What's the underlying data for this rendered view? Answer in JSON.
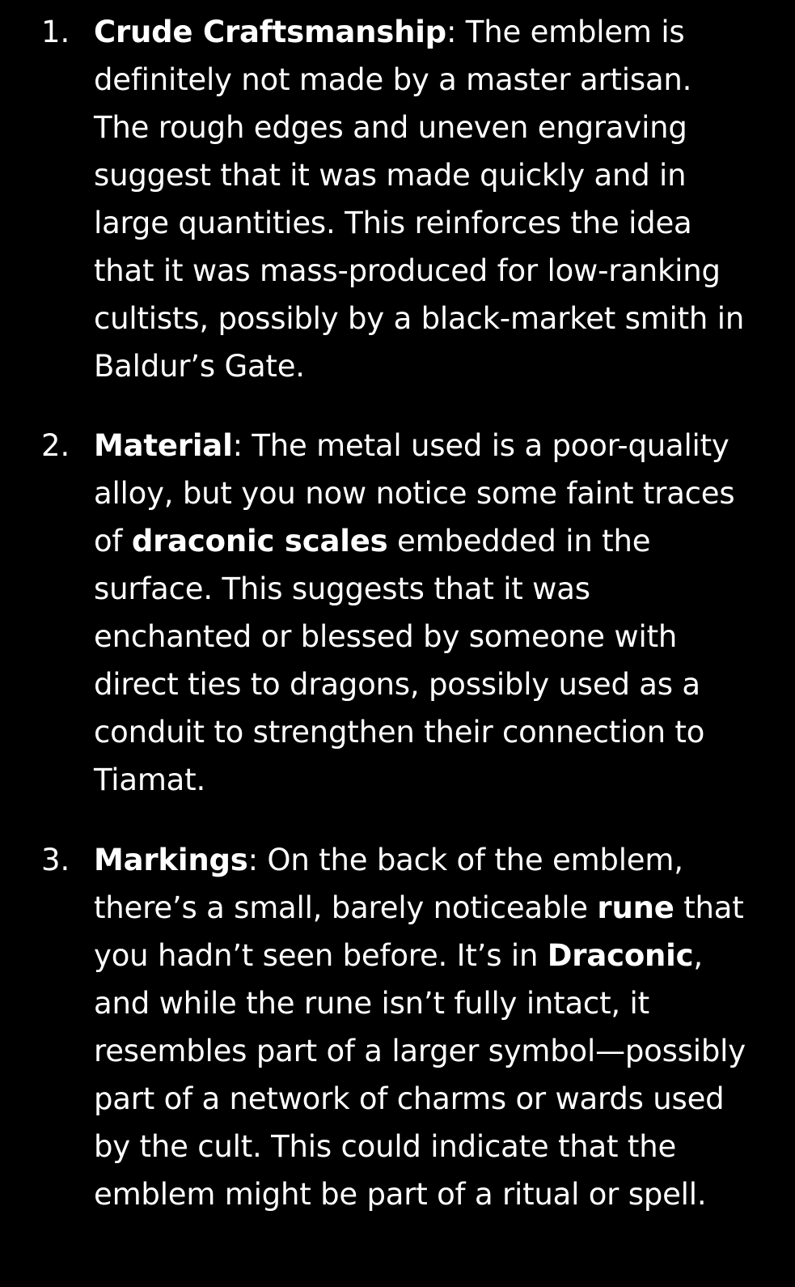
{
  "list": {
    "items": [
      {
        "number": "1.",
        "heading": "Crude Craftsmanship",
        "body": ": The emblem is definitely not made by a master artisan. The rough edges and uneven engraving suggest that it was made quickly and in large quantities. This reinforces the idea that it was mass-produced for low-ranking cultists, possibly by a black-market smith in Baldur’s Gate."
      },
      {
        "number": "2.",
        "heading": "Material",
        "body_1": ": The metal used is a poor-quality alloy, but you now notice some faint traces of ",
        "emphasis_1": "draconic scales",
        "body_2": " embedded in the surface. This suggests that it was enchanted or blessed by someone with direct ties to dragons, possibly used as a conduit to strengthen their connection to Tiamat."
      },
      {
        "number": "3.",
        "heading": "Markings",
        "body_1": ": On the back of the emblem, there’s a small, barely noticeable ",
        "emphasis_1": "rune",
        "body_2": " that you hadn’t seen before. It’s in ",
        "emphasis_2": "Draconic",
        "body_3": ", and while the rune isn’t fully intact, it resembles part of a larger symbol—possibly part of a network of charms or wards used by the cult. This could indicate that the emblem might be part of a ritual or spell."
      }
    ]
  },
  "colors": {
    "background": "#000000",
    "text": "#ffffff"
  }
}
